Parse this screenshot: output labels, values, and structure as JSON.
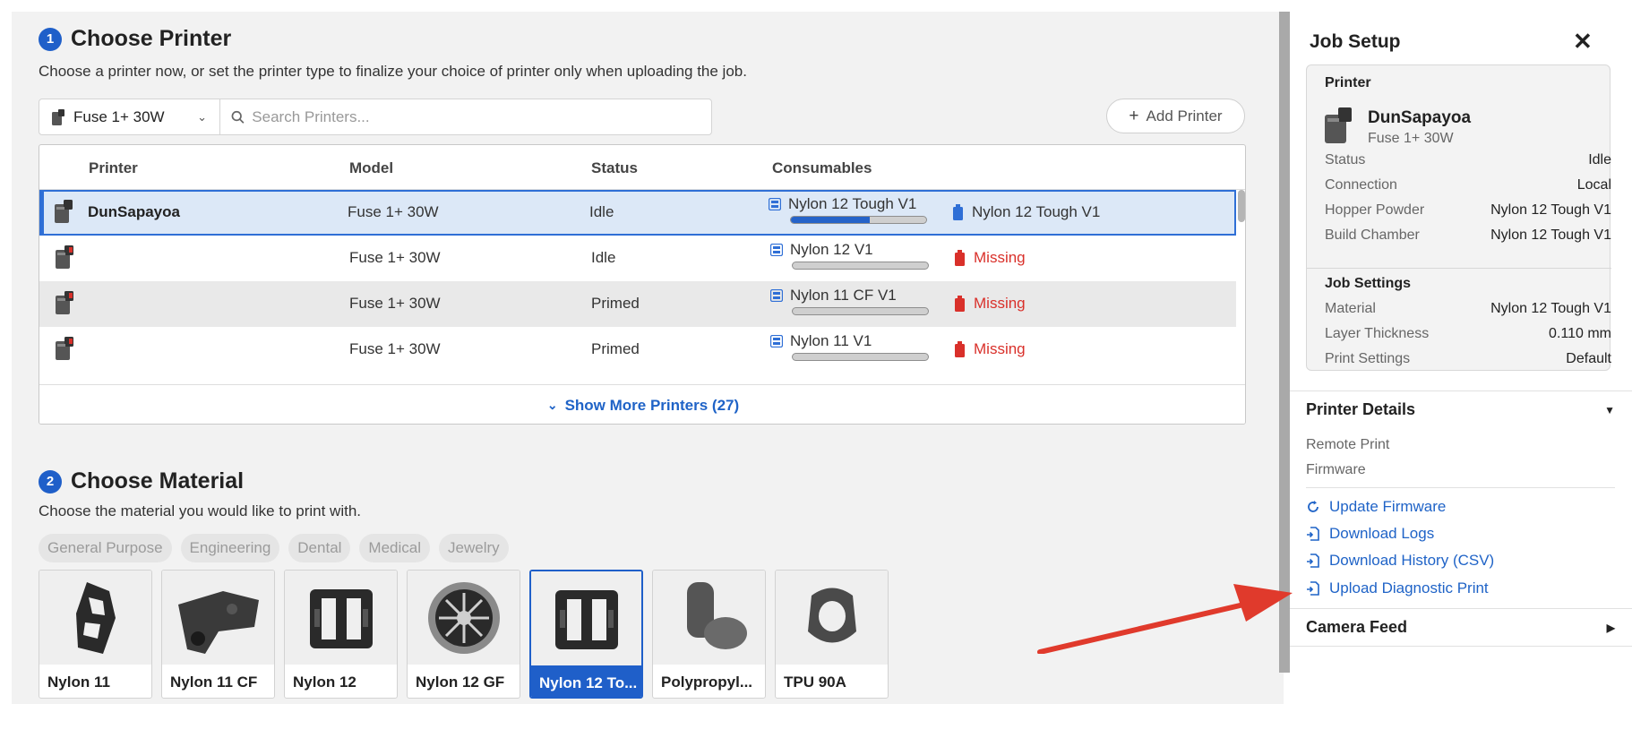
{
  "choose_printer": {
    "step": "1",
    "title": "Choose Printer",
    "description": "Choose a printer now, or set the printer type to finalize your choice of printer only when uploading the job.",
    "type_select": "Fuse 1+ 30W",
    "search_placeholder": "Search Printers...",
    "add_printer": "Add Printer",
    "columns": [
      "Printer",
      "Model",
      "Status",
      "Consumables"
    ],
    "rows": [
      {
        "name": "DunSapayoa",
        "model": "Fuse 1+ 30W",
        "status": "Idle",
        "powder": "Nylon 12 Tough V1",
        "powder_level": 0.58,
        "chamber": "Nylon 12 Tough V1",
        "chamber_missing": false
      },
      {
        "name": "",
        "model": "Fuse 1+ 30W",
        "status": "Idle",
        "powder": "Nylon 12 V1",
        "powder_level": 0.0,
        "chamber": "Missing",
        "chamber_missing": true
      },
      {
        "name": "",
        "model": "Fuse 1+ 30W",
        "status": "Primed",
        "powder": "Nylon 11 CF V1",
        "powder_level": 0.0,
        "chamber": "Missing",
        "chamber_missing": true
      },
      {
        "name": "",
        "model": "Fuse 1+ 30W",
        "status": "Primed",
        "powder": "Nylon 11 V1",
        "powder_level": 0.0,
        "chamber": "Missing",
        "chamber_missing": true
      }
    ],
    "show_more": "Show More Printers (27)"
  },
  "choose_material": {
    "step": "2",
    "title": "Choose Material",
    "description": "Choose the material you would like to print with.",
    "filters": [
      "General Purpose",
      "Engineering",
      "Dental",
      "Medical",
      "Jewelry"
    ],
    "materials": [
      "Nylon 11",
      "Nylon 11 CF",
      "Nylon 12",
      "Nylon 12 GF",
      "Nylon 12 To...",
      "Polypropyl...",
      "TPU 90A"
    ],
    "selected_index": 4
  },
  "job_setup": {
    "title": "Job Setup",
    "printer_label": "Printer",
    "printer_name": "DunSapayoa",
    "printer_model": "Fuse 1+ 30W",
    "printer_props": [
      {
        "k": "Status",
        "v": "Idle"
      },
      {
        "k": "Connection",
        "v": "Local"
      },
      {
        "k": "Hopper Powder",
        "v": "Nylon 12 Tough V1"
      },
      {
        "k": "Build Chamber",
        "v": "Nylon 12 Tough V1"
      }
    ],
    "job_settings_label": "Job Settings",
    "job_props": [
      {
        "k": "Material",
        "v": "Nylon 12 Tough V1"
      },
      {
        "k": "Layer Thickness",
        "v": "0.110 mm"
      },
      {
        "k": "Print Settings",
        "v": "Default"
      }
    ]
  },
  "printer_details": {
    "title": "Printer Details",
    "remote_print": "Remote Print",
    "firmware": "Firmware",
    "links": [
      "Update Firmware",
      "Download Logs",
      "Download History (CSV)",
      "Upload Diagnostic Print"
    ]
  },
  "camera_feed": {
    "title": "Camera Feed"
  },
  "colors": {
    "accent": "#1f5fc9",
    "missing": "#d9302a",
    "annotation_arrow": "#e03a2c"
  }
}
